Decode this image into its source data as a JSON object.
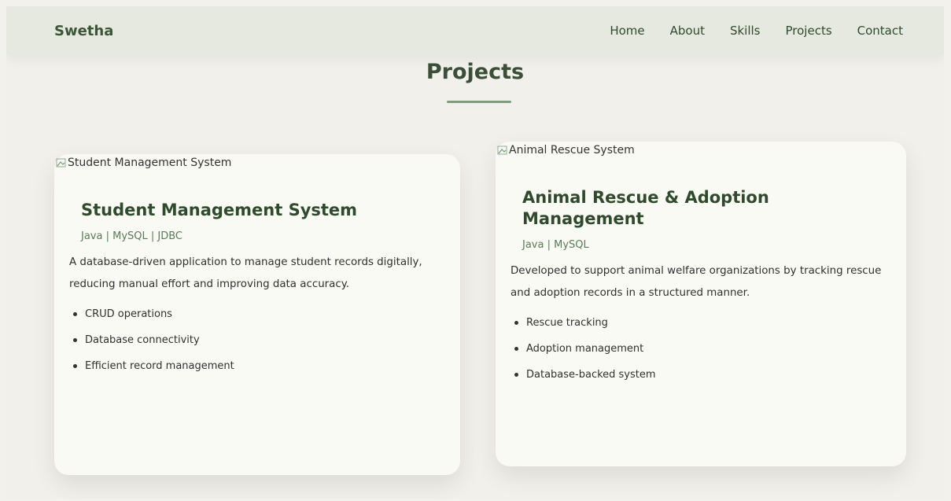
{
  "navbar": {
    "brand": "Swetha",
    "links": [
      "Home",
      "About",
      "Skills",
      "Projects",
      "Contact"
    ]
  },
  "section": {
    "title": "Projects"
  },
  "projects": [
    {
      "image_alt": "Student Management System",
      "title": "Student Management System",
      "tech": "Java | MySQL | JDBC",
      "description": "A database-driven application to manage student records digitally, reducing manual effort and improving data accuracy.",
      "features": [
        "CRUD operations",
        "Database connectivity",
        "Efficient record management"
      ]
    },
    {
      "image_alt": "Animal Rescue System",
      "title": "Animal Rescue & Adoption Management",
      "tech": "Java | MySQL",
      "description": "Developed to support animal welfare organizations by tracking rescue and adoption records in a structured manner.",
      "features": [
        "Rescue tracking",
        "Adoption management",
        "Database-backed system"
      ]
    }
  ]
}
